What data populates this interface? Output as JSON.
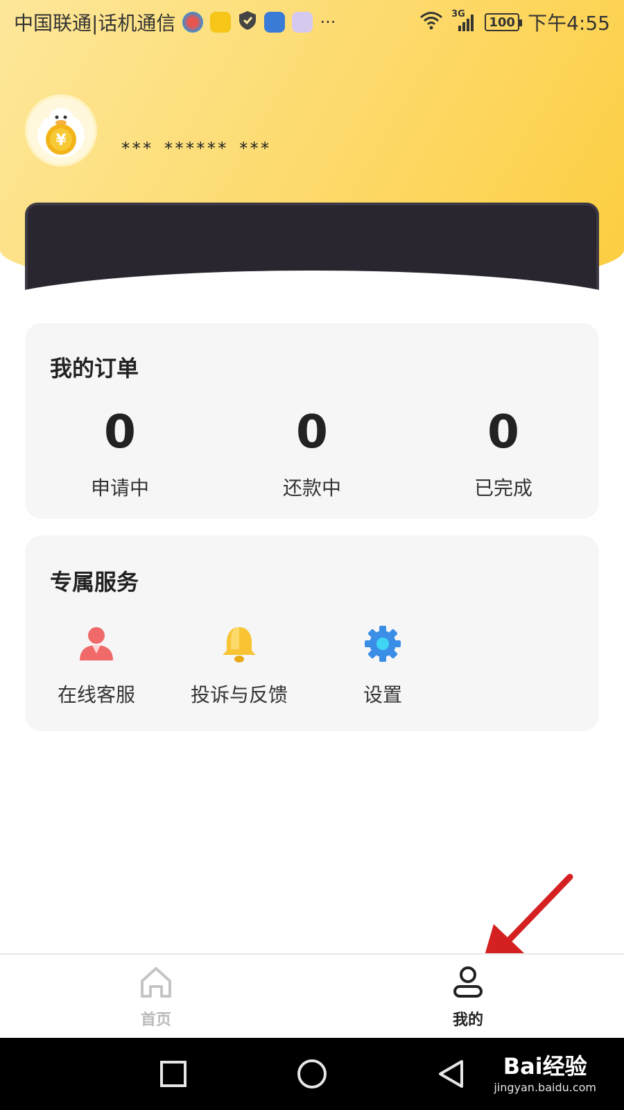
{
  "status_bar": {
    "carrier": "中国联通|话机通信",
    "network": "3G",
    "battery": "100",
    "time": "下午4:55"
  },
  "profile": {
    "masked_name": "*** ****** ***"
  },
  "orders": {
    "title": "我的订单",
    "items": [
      {
        "count": "0",
        "label": "申请中"
      },
      {
        "count": "0",
        "label": "还款中"
      },
      {
        "count": "0",
        "label": "已完成"
      }
    ]
  },
  "services": {
    "title": "专属服务",
    "items": [
      {
        "label": "在线客服",
        "icon": "customer-service-icon"
      },
      {
        "label": "投诉与反馈",
        "icon": "bell-icon"
      },
      {
        "label": "设置",
        "icon": "gear-icon"
      }
    ]
  },
  "tabbar": {
    "items": [
      {
        "label": "首页",
        "icon": "home-icon",
        "active": false
      },
      {
        "label": "我的",
        "icon": "user-icon",
        "active": true
      }
    ]
  },
  "watermark": {
    "brand": "Bai经验",
    "site": "jingyan.baidu.com"
  },
  "colors": {
    "header_gradient_start": "#fde79a",
    "header_gradient_end": "#fccd3f",
    "arrow": "#d42020",
    "active_tab": "#222222",
    "inactive_tab": "#bbbbbb"
  }
}
